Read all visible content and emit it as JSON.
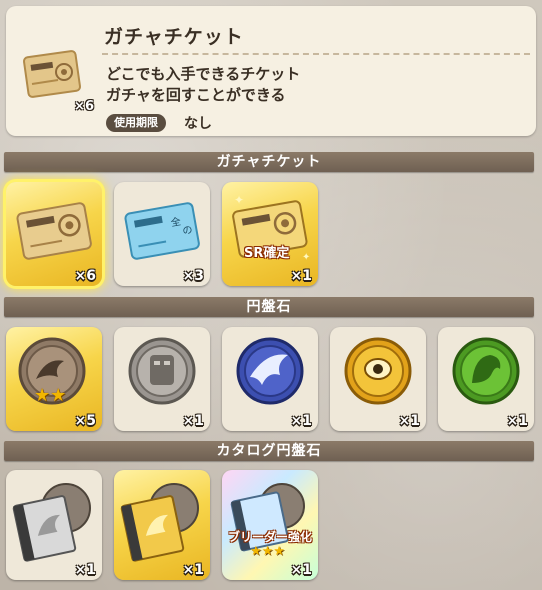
{
  "detail": {
    "title": "ガチャチケット",
    "count": "×6",
    "description_line1": "どこでも入手できるチケット",
    "description_line2": "ガチャを回すことができる",
    "expiry_label": "使用期限",
    "expiry_value": "なし",
    "icon": "gacha-ticket-icon"
  },
  "sections": {
    "gacha_tickets": {
      "header": "ガチャチケット",
      "items": [
        {
          "name": "gacha-ticket",
          "count": "×6"
        },
        {
          "name": "blue-ticket",
          "count": "×3"
        },
        {
          "name": "sr-guaranteed-ticket",
          "count": "×1",
          "tag": "SR確定"
        }
      ]
    },
    "medals": {
      "header": "円盤石",
      "items": [
        {
          "name": "dragon-medal",
          "count": "×5",
          "stars": "★★"
        },
        {
          "name": "stone-robot-medal",
          "count": "×1"
        },
        {
          "name": "blue-phoenix-medal",
          "count": "×1"
        },
        {
          "name": "yellow-eye-medal",
          "count": "×1"
        },
        {
          "name": "green-creature-medal",
          "count": "×1"
        }
      ]
    },
    "catalog_medals": {
      "header": "カタログ円盤石",
      "items": [
        {
          "name": "silver-catalog-medal",
          "count": "×1"
        },
        {
          "name": "gold-catalog-medal",
          "count": "×1"
        },
        {
          "name": "breeder-enhance-catalog",
          "count": "×1",
          "tag": "ブリーダー強化",
          "stars": "★★★"
        }
      ]
    }
  },
  "colors": {
    "gold_card": "#f7d54a",
    "header": "#7a6a5a",
    "panel": "#f6f0e2"
  }
}
